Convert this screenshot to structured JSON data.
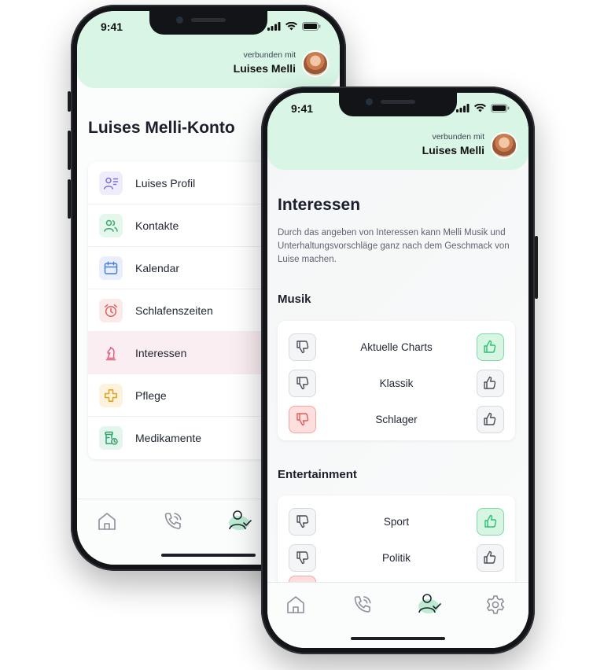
{
  "status": {
    "time": "9:41"
  },
  "connection": {
    "label": "verbunden mit",
    "name": "Luises Melli"
  },
  "account": {
    "title": "Luises Melli-Konto",
    "menu": [
      {
        "label": "Luises Profil",
        "icon": "profile-list-icon",
        "color": "#7c6fd6"
      },
      {
        "label": "Kontakte",
        "icon": "contacts-icon",
        "color": "#3aa86b"
      },
      {
        "label": "Kalendar",
        "icon": "calendar-icon",
        "color": "#4a7fd8"
      },
      {
        "label": "Schlafenszeiten",
        "icon": "alarm-clock-icon",
        "color": "#e0615f"
      },
      {
        "label": "Interessen",
        "icon": "chess-knight-icon",
        "color": "#e0607f"
      },
      {
        "label": "Pflege",
        "icon": "care-cross-icon",
        "color": "#e2a324"
      },
      {
        "label": "Medikamente",
        "icon": "medication-icon",
        "color": "#2fa46c"
      }
    ]
  },
  "interests": {
    "title": "Interessen",
    "description": "Durch das angeben von Interessen kann Melli Musik und Unterhaltungsvorschläge ganz nach dem Geschmack von Luise machen.",
    "sections": [
      {
        "title": "Musik",
        "items": [
          {
            "label": "Aktuelle Charts",
            "state": "up"
          },
          {
            "label": "Klassik",
            "state": "none"
          },
          {
            "label": "Schlager",
            "state": "down"
          }
        ]
      },
      {
        "title": "Entertainment",
        "items": [
          {
            "label": "Sport",
            "state": "up"
          },
          {
            "label": "Politik",
            "state": "none"
          }
        ]
      }
    ]
  },
  "nav": [
    "home-icon",
    "phone-icon",
    "account-icon",
    "settings-icon"
  ],
  "colors": {
    "header": "#d8f5e6",
    "accent_green": "#2fbf71",
    "accent_red": "#e05a5a"
  }
}
